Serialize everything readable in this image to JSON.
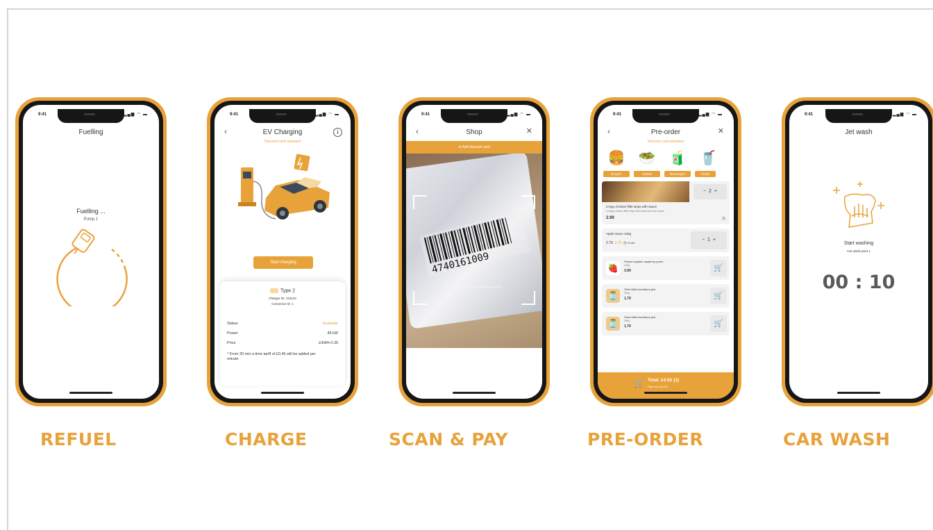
{
  "status_time": "9:41",
  "colors": {
    "accent": "#e8a23a",
    "text": "#333333"
  },
  "refuel": {
    "title": "Fuelling",
    "status": "Fuelling ...",
    "pump": "Pump 1",
    "caption": "REFUEL"
  },
  "charge": {
    "title": "EV Charging",
    "discount": "Discount card activated",
    "start_button": "Start charging",
    "connector_type": "Type 2",
    "charger_id": "Charger ID: 123123",
    "connector_id": "Connector ID: 1",
    "rows": [
      {
        "label": "Status",
        "value": "Available"
      },
      {
        "label": "Power",
        "value": "45 kW"
      },
      {
        "label": "Price",
        "value": "£/kWh 0.39"
      }
    ],
    "note": "* From 30 min a time tariff of £0.45 will be added per minute",
    "caption": "CHARGE"
  },
  "shop": {
    "title": "Shop",
    "discount_bar": "Add discount card",
    "scan_hint": "Place the screen to scan the product",
    "barcode_number": "4740161009",
    "caption": "SCAN & PAY"
  },
  "preorder": {
    "title": "Pre-order",
    "discount": "Discount card activated",
    "categories": [
      "Burgers",
      "Salads",
      "Beverages",
      "Drinks"
    ],
    "featured": {
      "name": "Crispy chicken fillet strips with sauce",
      "desc": "6 crispy chicken fillet strips with sweet and sour sauce",
      "price": "2.99",
      "qty": "2"
    },
    "item2": {
      "name": "Apple sauce 100g",
      "price_old": "2.79",
      "price_new": "1.79",
      "time": "10 min",
      "qty": "1"
    },
    "items": [
      {
        "name": "Farmer organic raspberry puree",
        "size": "400g",
        "price": "3.99"
      },
      {
        "name": "Oliva Wafi cloudberry jam",
        "size": "350g",
        "price": "1.79"
      },
      {
        "name": "Oliva Wafi cloudberry jam",
        "size": "350g",
        "price": "1.79"
      }
    ],
    "total": "Total: £4.92 (3)",
    "total_sub": "Pay now | £1.90",
    "caption": "PRE-ORDER"
  },
  "carwash": {
    "title": "Jet wash",
    "status": "Start washing",
    "point": "Car wash point 1",
    "timer": "00 : 10",
    "caption": "CAR WASH"
  }
}
